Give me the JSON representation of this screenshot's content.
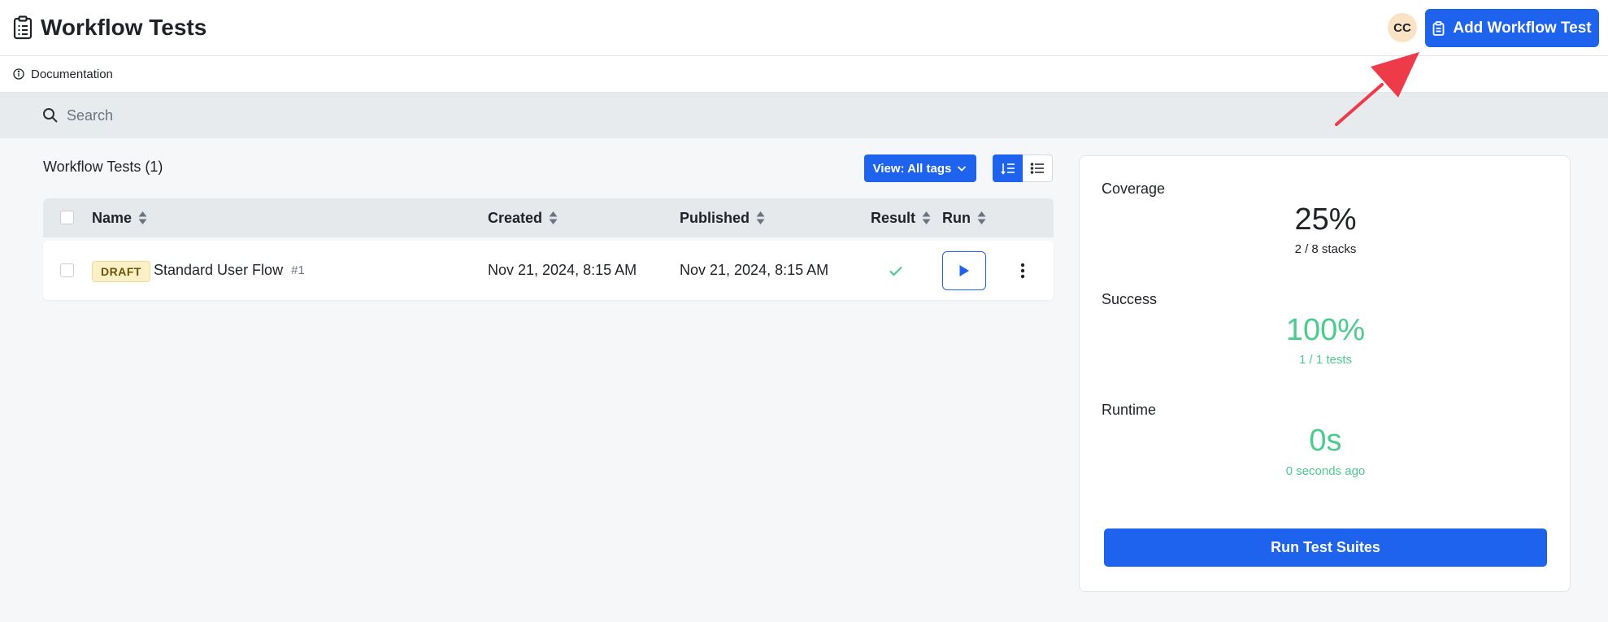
{
  "header": {
    "title": "Workflow Tests",
    "avatar_initials": "CC",
    "add_button_label": "Add Workflow Test"
  },
  "docs": {
    "label": "Documentation"
  },
  "search": {
    "placeholder": "Search"
  },
  "list": {
    "title": "Workflow Tests (1)",
    "view_filter_label": "View: All tags",
    "columns": {
      "name": "Name",
      "created": "Created",
      "published": "Published",
      "result": "Result",
      "run": "Run"
    },
    "rows": [
      {
        "status": "DRAFT",
        "name": "Standard User Flow",
        "number": "#1",
        "created": "Nov 21, 2024, 8:15 AM",
        "published": "Nov 21, 2024, 8:15 AM",
        "result": "passed"
      }
    ]
  },
  "stats": {
    "coverage_label": "Coverage",
    "coverage_value": "25%",
    "coverage_sub": "2 / 8 stacks",
    "success_label": "Success",
    "success_value": "100%",
    "success_sub": "1 / 1 tests",
    "runtime_label": "Runtime",
    "runtime_value": "0s",
    "runtime_sub": "0 seconds ago",
    "run_button_label": "Run Test Suites"
  },
  "colors": {
    "primary": "#1d63ed",
    "success": "#4ccb8f",
    "annotation_arrow": "#ee3b4a",
    "draft_badge_bg": "#fcf0c6"
  },
  "icons": {
    "title": "clipboard-list-icon",
    "add_button": "clipboard-icon",
    "docs": "info-circle-icon",
    "search": "search-icon",
    "view_filter": "chevron-down-icon",
    "sort": "sort-icon",
    "result": "check-icon",
    "run": "play-icon",
    "row_menu": "kebab-menu-icon",
    "view_ordered": "ordered-list-icon",
    "view_list": "unordered-list-icon",
    "annotation": "arrow-icon"
  }
}
